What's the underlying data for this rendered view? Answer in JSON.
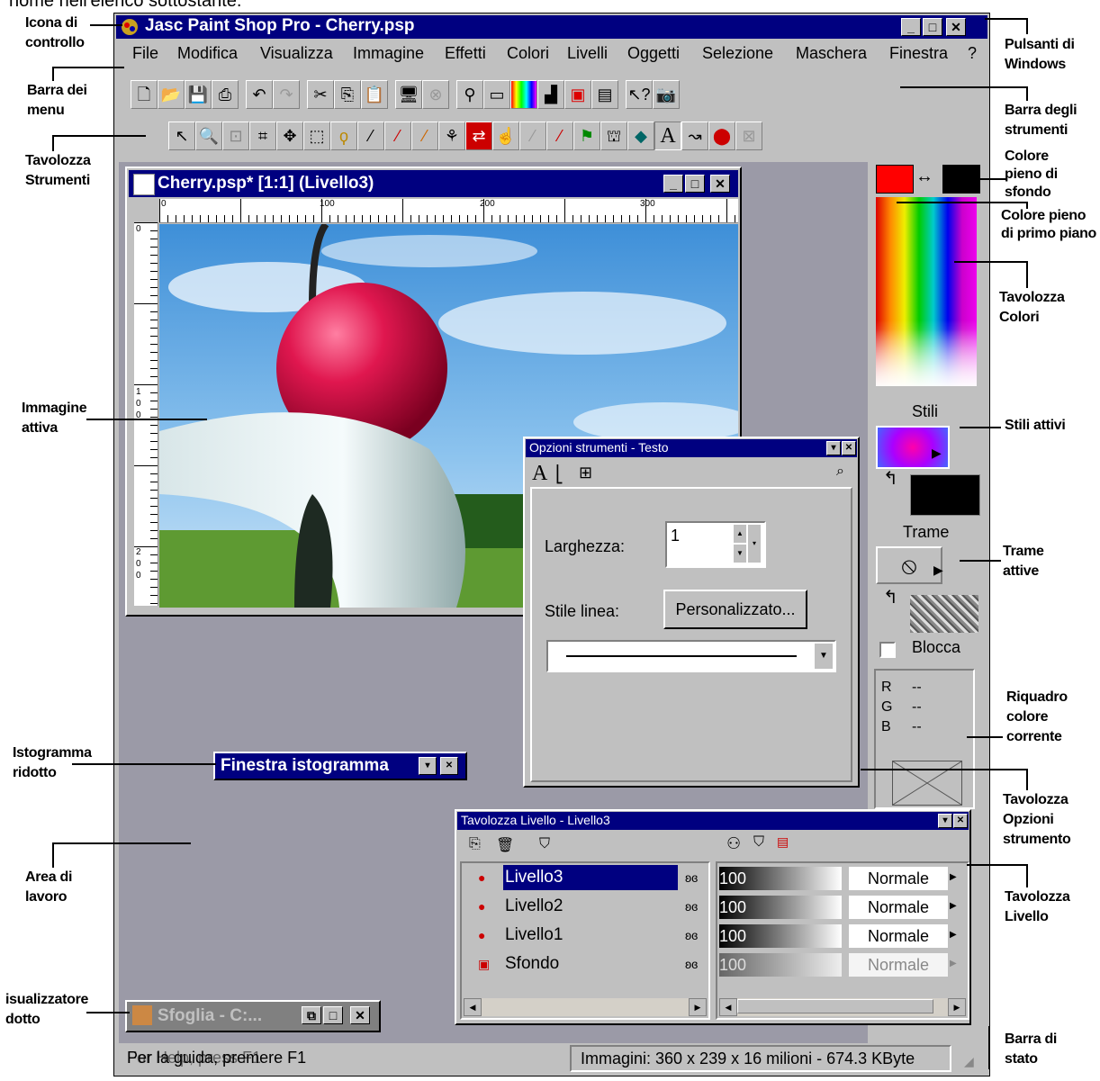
{
  "top_caption": "nome nell'elenco sottostante.",
  "annotations": {
    "icona_controllo": "Icona di controllo",
    "barra_menu": "Barra dei menu",
    "tavolozza_strumenti": "Tavolozza Strumenti",
    "immagine_attiva": "Immagine attiva",
    "istogramma_ridotto": "Istogramma ridotto",
    "area_lavoro": "Area di lavoro",
    "visualizzatore": "isualizzatore dotto",
    "pulsanti_windows": "Pulsanti di Windows",
    "barra_strumenti": "Barra degli strumenti",
    "colore_sfondo": "Colore pieno di sfondo",
    "colore_primo_piano": "Colore pieno di primo piano",
    "tavolozza_colori": "Tavolozza Colori",
    "stili_attivi": "Stili attivi",
    "trame_attive": "Trame attive",
    "riquadro_colore": "Riquadro colore corrente",
    "tavolozza_opzioni": "Tavolozza Opzioni strumento",
    "tavolozza_livello": "Tavolozza Livello",
    "barra_stato": "Barra di stato"
  },
  "app": {
    "title": "Jasc Paint Shop Pro - Cherry.psp",
    "menu": [
      "File",
      "Modifica",
      "Visualizza",
      "Immagine",
      "Effetti",
      "Colori",
      "Livelli",
      "Oggetti",
      "Selezione",
      "Maschera",
      "Finestra",
      "?"
    ]
  },
  "image_window": {
    "title": "Cherry.psp* [1:1] (Livello3)",
    "ruler_ticks": [
      "0",
      "100",
      "200",
      "300"
    ],
    "vruler_ticks": [
      "0",
      "1\n0\n0",
      "2\n0\n0"
    ]
  },
  "palette": {
    "stili_label": "Stili",
    "trame_label": "Trame",
    "blocca_label": "Blocca",
    "rgb": [
      {
        "k": "R",
        "v": "--"
      },
      {
        "k": "G",
        "v": "--"
      },
      {
        "k": "B",
        "v": "--"
      }
    ]
  },
  "tool_options": {
    "title": "Opzioni strumenti - Testo",
    "larghezza_label": "Larghezza:",
    "larghezza_value": "1",
    "stile_linea_label": "Stile linea:",
    "personalizzato_label": "Personalizzato..."
  },
  "histogram": {
    "title": "Finestra istogramma"
  },
  "layers": {
    "title": "Tavolozza Livello - Livello3",
    "rows": [
      {
        "name": "Livello3",
        "opacity": "100",
        "mode": "Normale"
      },
      {
        "name": "Livello2",
        "opacity": "100",
        "mode": "Normale"
      },
      {
        "name": "Livello1",
        "opacity": "100",
        "mode": "Normale"
      },
      {
        "name": "Sfondo",
        "opacity": "100",
        "mode": "Normale"
      }
    ]
  },
  "browser": {
    "title": "Sfoglia - C:..."
  },
  "status": {
    "help": "Per la guida, premere F1",
    "help_overlay": "For Help, press F1",
    "info": "Immagini: 360 x 239 x 16 milioni   - 674.3 KByte"
  },
  "colors": {
    "title_blue": "#000080",
    "workspace": "#9b9aa7",
    "foreground": "#ff0000",
    "background": "#000000"
  }
}
